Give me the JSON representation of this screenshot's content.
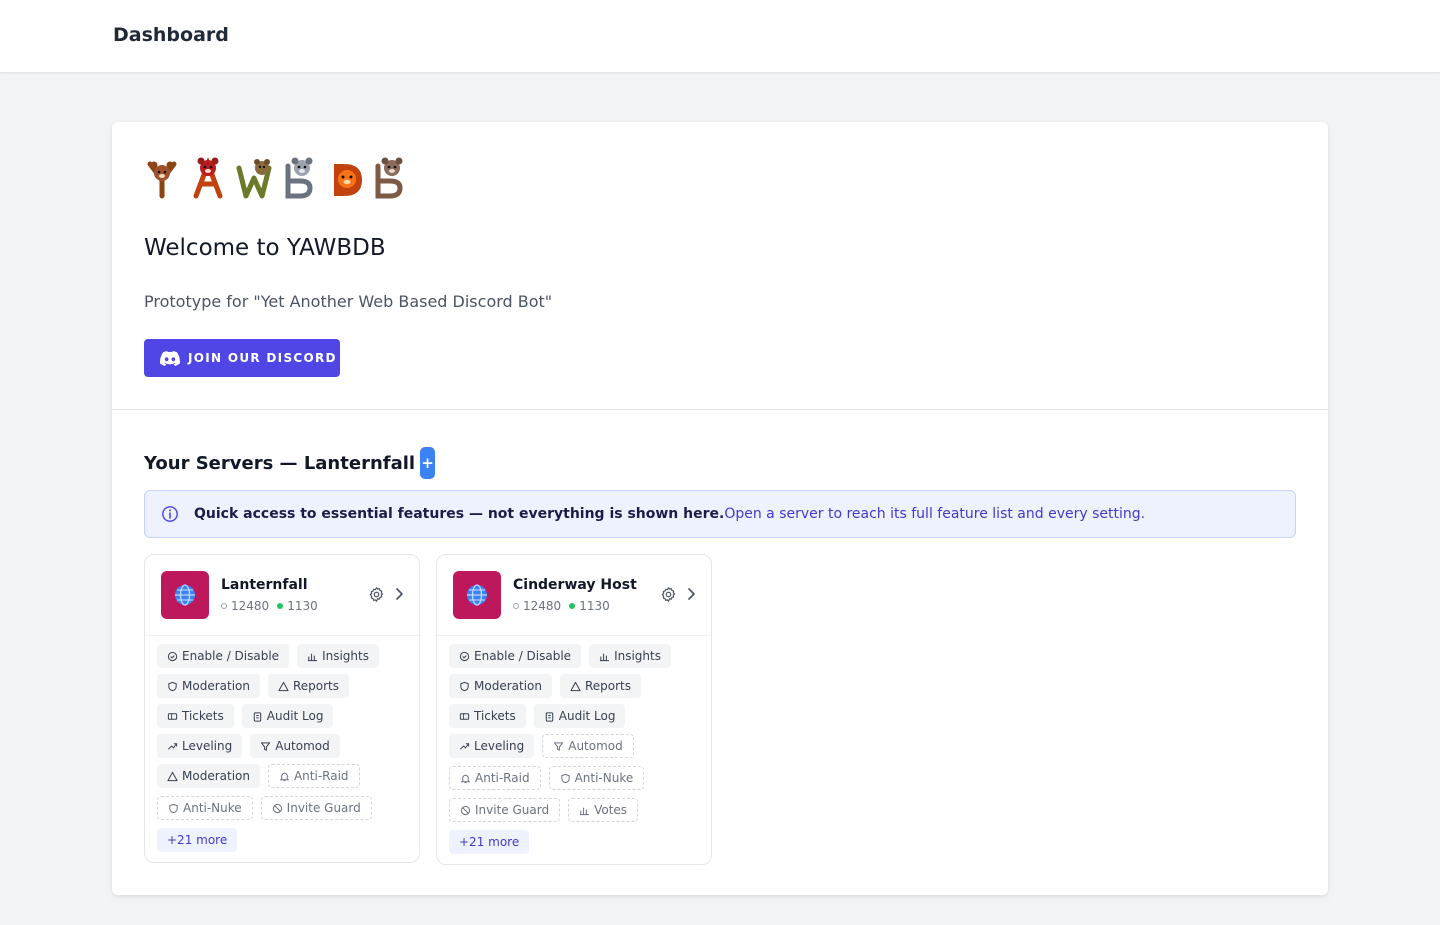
{
  "header": {
    "title": "Dashboard"
  },
  "hero": {
    "logo_text": "YAWBDB",
    "welcome": "Welcome to YAWBDB",
    "subtitle": "Prototype for \"Yet Another Web Based Discord Bot\"",
    "join_label": "JOIN OUR DISCORD"
  },
  "servers": {
    "heading": "Your Servers — Lanternfall",
    "add_label": "+",
    "notice_strong": "Quick access to essential features — not everything is shown here.",
    "notice_rest": "Open a server to reach its full feature list and every setting.",
    "cards": [
      {
        "name": "Lanternfall",
        "members": "12480",
        "online": "1130",
        "tags": [
          {
            "label": "Enable / Disable",
            "icon": "toggle-icon"
          },
          {
            "label": "Insights",
            "icon": "chart-icon"
          },
          {
            "label": "Moderation",
            "icon": "shield-icon"
          },
          {
            "label": "Reports",
            "icon": "warning-icon"
          },
          {
            "label": "Tickets",
            "icon": "ticket-icon"
          },
          {
            "label": "Audit Log",
            "icon": "clipboard-icon"
          },
          {
            "label": "Leveling",
            "icon": "trend-icon"
          },
          {
            "label": "Automod",
            "icon": "filter-icon"
          },
          {
            "label": "Moderation",
            "icon": "warning-icon"
          },
          {
            "label": "Anti-Raid",
            "icon": "bell-icon"
          },
          {
            "label": "Anti-Nuke",
            "icon": "shield-icon"
          },
          {
            "label": "Invite Guard",
            "icon": "ban-icon"
          }
        ],
        "more": "+21 more"
      },
      {
        "name": "Cinderway Host",
        "members": "12480",
        "online": "1130",
        "tags": [
          {
            "label": "Enable / Disable",
            "icon": "toggle-icon"
          },
          {
            "label": "Insights",
            "icon": "chart-icon"
          },
          {
            "label": "Moderation",
            "icon": "shield-icon"
          },
          {
            "label": "Reports",
            "icon": "warning-icon"
          },
          {
            "label": "Tickets",
            "icon": "ticket-icon"
          },
          {
            "label": "Audit Log",
            "icon": "clipboard-icon"
          },
          {
            "label": "Leveling",
            "icon": "trend-icon"
          },
          {
            "label": "Automod",
            "icon": "filter-icon"
          },
          {
            "label": "Anti-Raid",
            "icon": "bell-icon"
          },
          {
            "label": "Anti-Nuke",
            "icon": "shield-icon"
          },
          {
            "label": "Invite Guard",
            "icon": "ban-icon"
          },
          {
            "label": "Votes",
            "icon": "chart-icon"
          }
        ],
        "more": "+21 more"
      }
    ]
  },
  "colors": {
    "accent": "#4f46e5",
    "add_button": "#3b82f6",
    "server_avatar": "#be185d",
    "online_dot": "#22c55e",
    "notice_bg": "#eef2ff"
  }
}
